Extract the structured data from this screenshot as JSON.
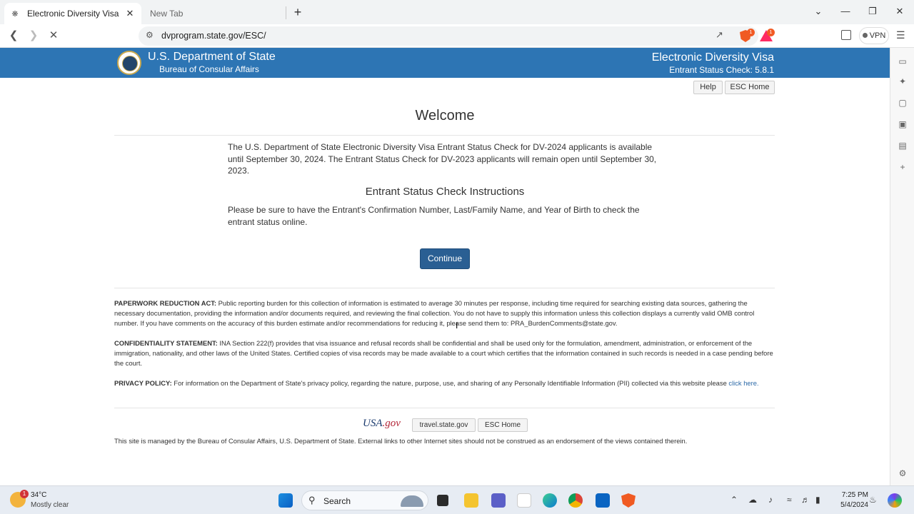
{
  "browser": {
    "active_tab_title": "Electronic Diversity Visa",
    "inactive_tab_title": "New Tab",
    "url": "dvprogram.state.gov/ESC/",
    "shield_badge": "1",
    "reward_badge": "1",
    "vpn_label": "VPN"
  },
  "banner": {
    "department": "U.S. Department of State",
    "bureau": "Bureau of Consular Affairs",
    "program": "Electronic Diversity Visa",
    "version": "Entrant Status Check: 5.8.1"
  },
  "top_buttons": {
    "help": "Help",
    "esc_home": "ESC Home"
  },
  "main": {
    "welcome": "Welcome",
    "intro": "The U.S. Department of State Electronic Diversity Visa Entrant Status Check for DV-2024 applicants is available until September 30, 2024. The Entrant Status Check for DV-2023 applicants will remain open until September 30, 2023.",
    "instructions_title": "Entrant Status Check Instructions",
    "instructions": "Please be sure to have the Entrant's Confirmation Number, Last/Family Name, and Year of Birth to check the entrant status online.",
    "continue": "Continue"
  },
  "legal": {
    "paperwork_label": "PAPERWORK REDUCTION ACT:",
    "paperwork_text": " Public reporting burden for this collection of information is estimated to average 30 minutes per response, including time required for searching existing data sources, gathering the necessary documentation, providing the information and/or documents required, and reviewing the final collection. You do not have to supply this information unless this collection displays a currently valid OMB control number. If you have comments on the accuracy of this burden estimate and/or recommendations for reducing it, please send them to: PRA_BurdenComments@state.gov.",
    "confidentiality_label": "CONFIDENTIALITY STATEMENT:",
    "confidentiality_text": " INA Section 222(f) provides that visa issuance and refusal records shall be confidential and shall be used only for the formulation, amendment, administration, or enforcement of the immigration, nationality, and other laws of the United States. Certified copies of visa records may be made available to a court which certifies that the information contained in such records is needed in a case pending before the court.",
    "privacy_label": "PRIVACY POLICY:",
    "privacy_text": " For information on the Department of State's privacy policy, regarding the nature, purpose, use, and sharing of any Personally Identifiable Information (PII) collected via this website please ",
    "privacy_link": "click here."
  },
  "footer": {
    "usa_gov_main": "USA",
    "usa_gov_suffix": ".gov",
    "travel": "travel.state.gov",
    "esc_home": "ESC Home",
    "note": "This site is managed by the Bureau of Consular Affairs, U.S. Department of State. External links to other Internet sites should not be construed as an endorsement of the views contained therein."
  },
  "taskbar": {
    "weather_badge": "1",
    "temperature": "34°C",
    "condition": "Mostly clear",
    "search_label": "Search",
    "time": "7:25 PM",
    "date": "5/4/2024"
  },
  "colors": {
    "banner": "#2d75b4",
    "continue_button": "#2a5f93",
    "link": "#2d6aa8"
  }
}
